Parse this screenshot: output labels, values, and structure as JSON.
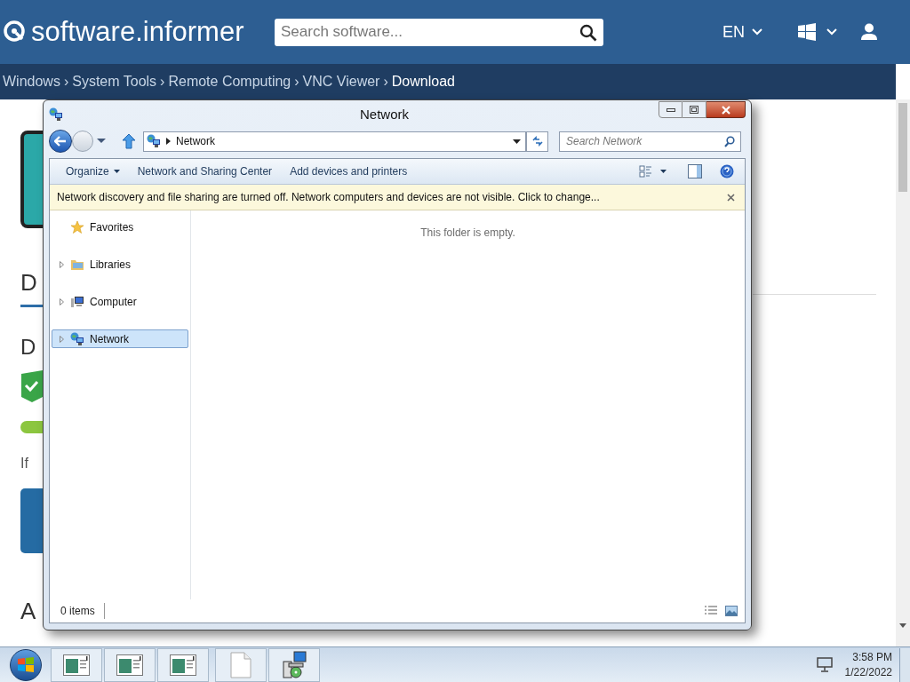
{
  "site": {
    "logo": "software.informer",
    "search_placeholder": "Search software...",
    "language": "EN"
  },
  "breadcrumb_separator": "›",
  "breadcrumb": [
    {
      "label": "Windows",
      "current": false
    },
    {
      "label": "System Tools",
      "current": false
    },
    {
      "label": "Remote Computing",
      "current": false
    },
    {
      "label": "VNC Viewer",
      "current": false
    },
    {
      "label": "Download",
      "current": true
    }
  ],
  "page_fragments": [
    {
      "kind": "heading",
      "text": "D"
    },
    {
      "kind": "subheading",
      "text": "D"
    },
    {
      "kind": "text",
      "text": "If"
    },
    {
      "kind": "heading",
      "text": "A"
    }
  ],
  "explorer": {
    "title": "Network",
    "address": "Network",
    "search_placeholder": "Search Network",
    "toolbar": [
      {
        "label": "Organize",
        "dropdown": true
      },
      {
        "label": "Network and Sharing Center",
        "dropdown": false
      },
      {
        "label": "Add devices and printers",
        "dropdown": false
      }
    ],
    "infobar": "Network discovery and file sharing are turned off. Network computers and devices are not visible. Click to change...",
    "nav": [
      {
        "label": "Favorites",
        "kind": "star",
        "expandable": false,
        "selected": false
      },
      {
        "label": "Libraries",
        "kind": "folder",
        "expandable": true,
        "selected": false
      },
      {
        "label": "Computer",
        "kind": "computer",
        "expandable": true,
        "selected": false
      },
      {
        "label": "Network",
        "kind": "network",
        "expandable": true,
        "selected": true
      }
    ],
    "empty_message": "This folder is empty.",
    "status": "0 items"
  },
  "taskbar": {
    "buttons": [
      {
        "kind": "window"
      },
      {
        "kind": "window"
      },
      {
        "kind": "window"
      },
      {
        "kind": "file"
      },
      {
        "kind": "installer"
      }
    ],
    "time": "3:58 PM",
    "date": "1/22/2022"
  }
}
